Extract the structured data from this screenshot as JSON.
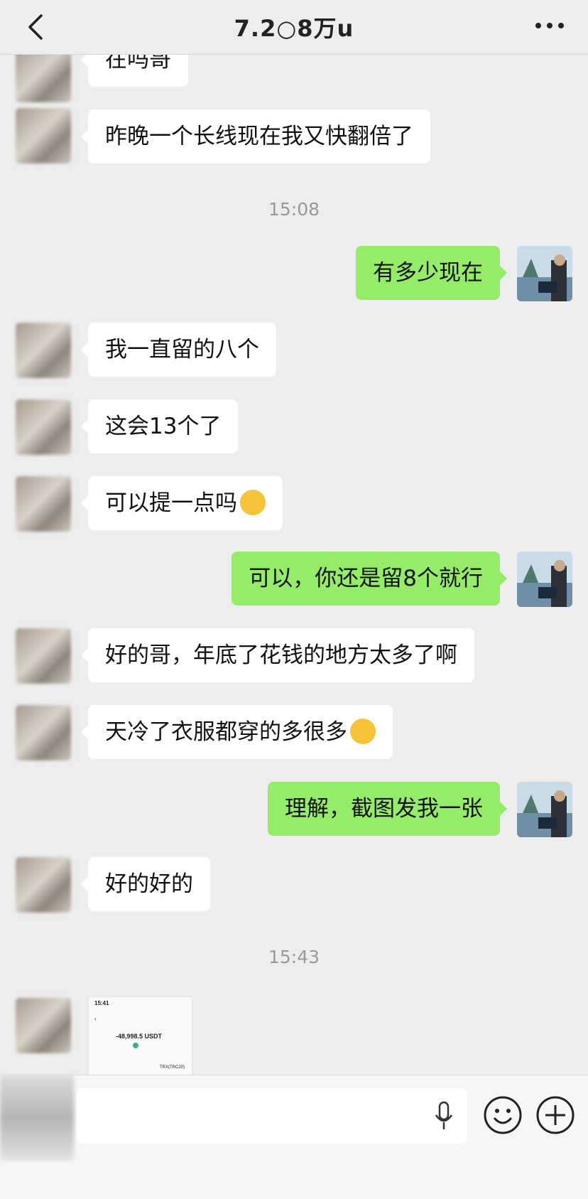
{
  "header": {
    "title": "7.2○8万u",
    "back_icon": "chevron-left-icon",
    "more_icon": "more-dots-icon"
  },
  "messages": [
    {
      "side": "in",
      "text": "在吗哥"
    },
    {
      "side": "in",
      "text": "昨晚一个长线现在我又快翻倍了"
    },
    {
      "type": "time",
      "text": "15:08"
    },
    {
      "side": "out",
      "text": "有多少现在"
    },
    {
      "side": "in",
      "text": "我一直留的八个"
    },
    {
      "side": "in",
      "text": "这会13个了"
    },
    {
      "side": "in",
      "text": "可以提一点吗",
      "emoji": "grin-emoji"
    },
    {
      "side": "out",
      "text": "可以，你还是留8个就行"
    },
    {
      "side": "in",
      "text": "好的哥，年底了花钱的地方太多了啊"
    },
    {
      "side": "in",
      "text": "天冷了衣服都穿的多很多",
      "emoji": "sad-emoji"
    },
    {
      "side": "out",
      "text": "理解，截图发我一张"
    },
    {
      "side": "in",
      "text": "好的好的"
    },
    {
      "type": "time",
      "text": "15:43"
    }
  ],
  "image_message": {
    "time": "15:41",
    "amount": "-48,998.5 USDT",
    "network": "TRX(TRC20)"
  },
  "inputbar": {
    "mic_icon": "microphone-icon",
    "emoji_icon": "smile-icon",
    "plus_icon": "plus-circle-icon"
  }
}
